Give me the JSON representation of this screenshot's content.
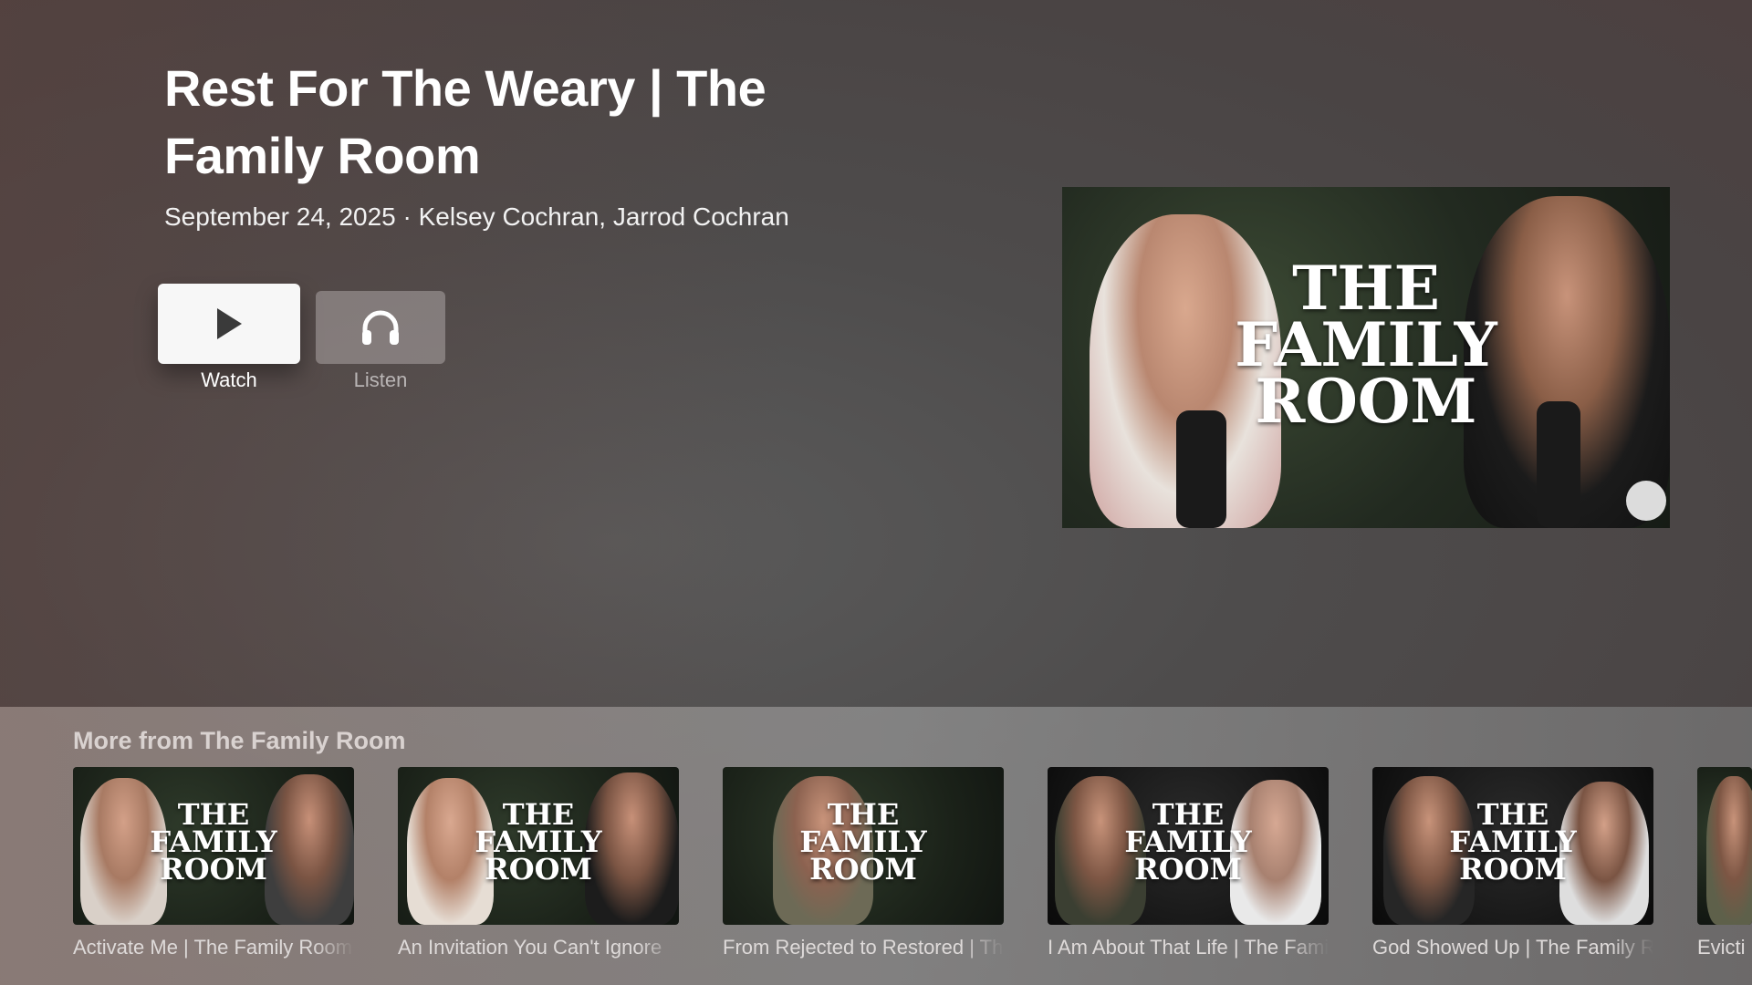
{
  "hero": {
    "title": "Rest For The Weary | The Family Room",
    "meta": "September 24, 2025 · Kelsey Cochran, Jarrod Cochran",
    "artwork_text": [
      "THE",
      "FAMILY",
      "ROOM"
    ]
  },
  "actions": {
    "watch_label": "Watch",
    "listen_label": "Listen",
    "watch_icon": "play-icon",
    "listen_icon": "headphones-icon"
  },
  "shelf": {
    "title": "More from The Family Room",
    "items": [
      {
        "title": "Activate Me | The Family Room"
      },
      {
        "title": "An Invitation You Can't Ignore"
      },
      {
        "title": "From Rejected to Restored | The Family Room"
      },
      {
        "title": "I Am About That Life | The Family Room"
      },
      {
        "title": "God Showed Up | The Family Room"
      },
      {
        "title": "Evicti"
      }
    ]
  },
  "colors": {
    "accent_button": "#f7f7f7",
    "shelf_bg": "#969090"
  }
}
